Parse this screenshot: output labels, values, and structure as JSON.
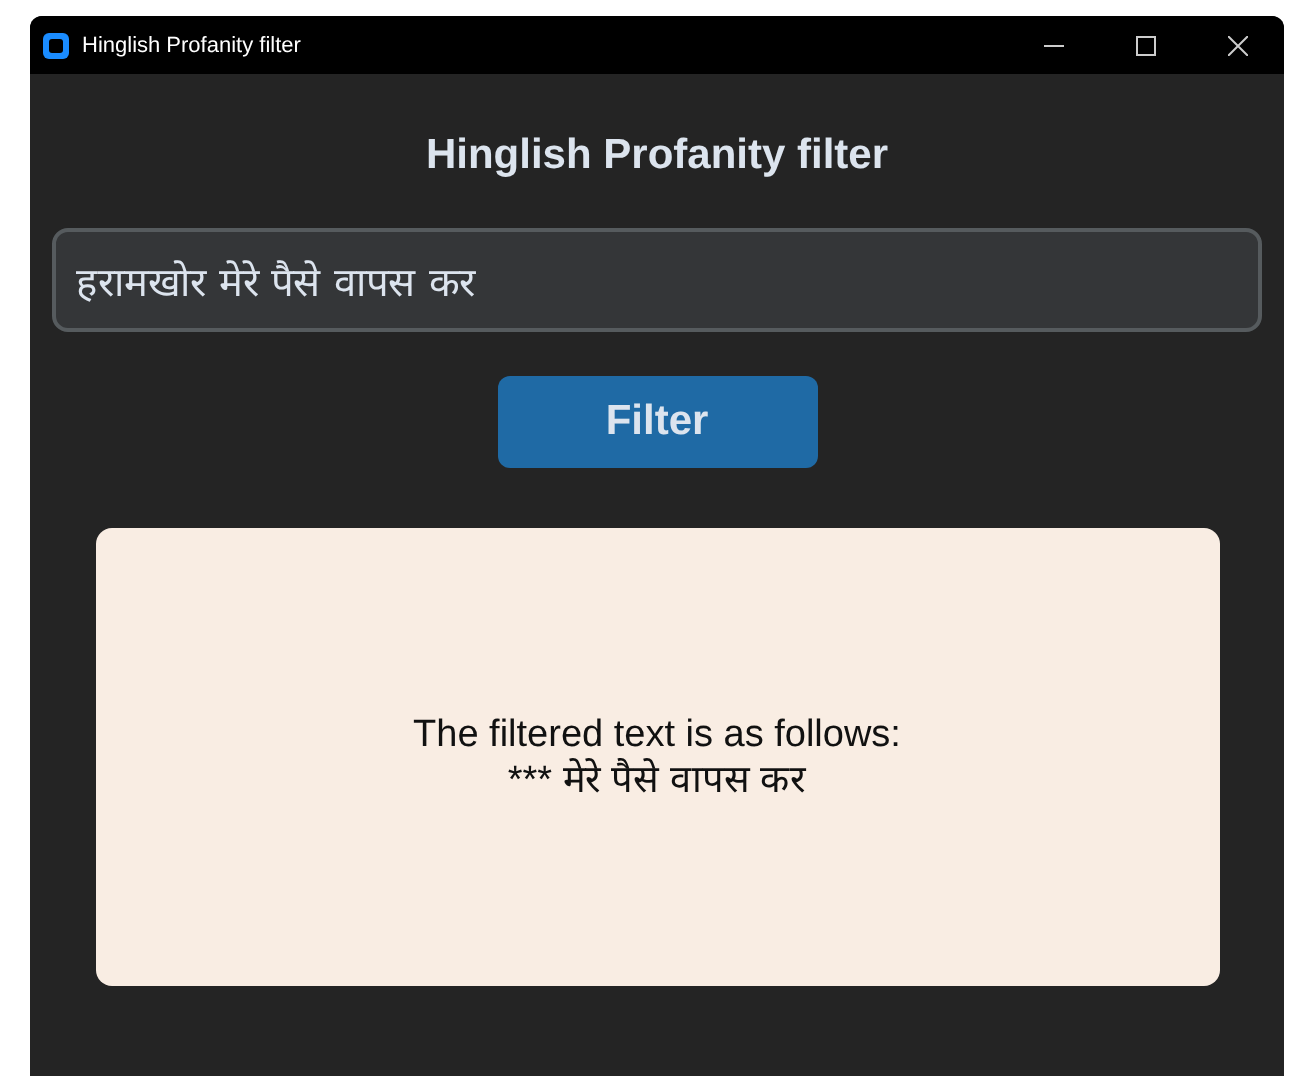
{
  "window": {
    "title": "Hinglish Profanity filter"
  },
  "heading": "Hinglish Profanity filter",
  "input": {
    "value": "हरामखोर मेरे पैसे वापस कर"
  },
  "button": {
    "label": "Filter"
  },
  "result": {
    "caption": "The filtered text is as follows:",
    "text": "*** मेरे पैसे वापस कर"
  }
}
